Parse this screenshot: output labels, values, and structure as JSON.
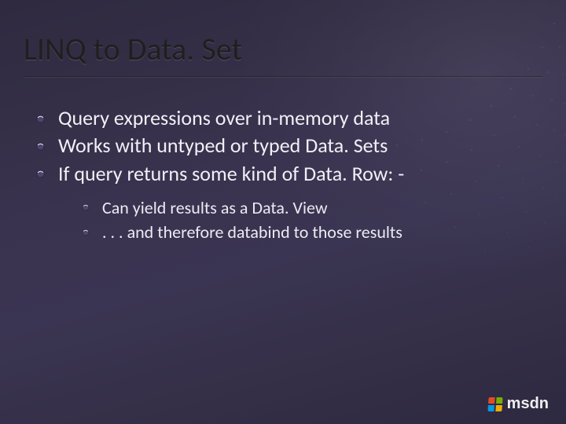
{
  "title": "LINQ to Data. Set",
  "bullets_level1": [
    "Query expressions over in-memory data",
    "Works with untyped or typed Data. Sets",
    "If query returns some kind of Data. Row: -"
  ],
  "bullets_level2": [
    "Can yield results as a Data. View",
    ". . . and therefore databind to those results"
  ],
  "footer": {
    "brand": "msdn"
  },
  "colors": {
    "bullet_accent_dark": "#5a4f7a",
    "bullet_accent_light": "#cfc6e6"
  }
}
